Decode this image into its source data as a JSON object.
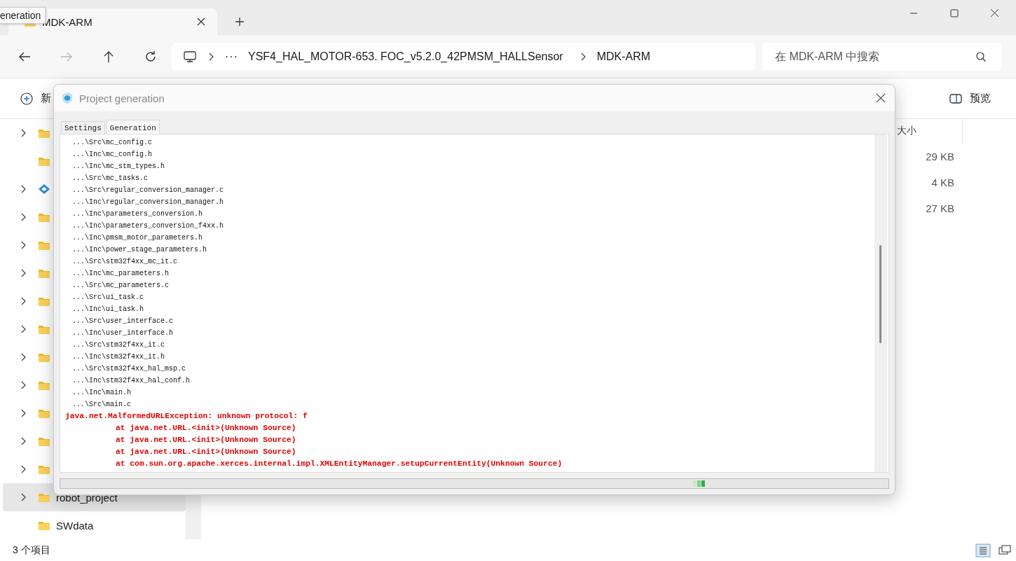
{
  "tooltip": {
    "text": "eneration"
  },
  "tab": {
    "title": "MDK-ARM"
  },
  "nav_buttons": [
    {
      "kind": "back",
      "disabled": false
    },
    {
      "kind": "forward",
      "disabled": true
    },
    {
      "kind": "up",
      "disabled": false
    },
    {
      "kind": "refresh",
      "disabled": false
    }
  ],
  "address": {
    "more": "···",
    "segments": [
      "YSF4_HAL_MOTOR-653. FOC_v5.2.0_42PMSM_HALLSensor",
      "MDK-ARM"
    ]
  },
  "search": {
    "placeholder": "在 MDK-ARM 中搜索"
  },
  "command_bar": {
    "new_label": "新",
    "preview_label": "预览"
  },
  "nav_pane": [
    {
      "kind": "folder",
      "expandable": true,
      "selected": false
    },
    {
      "kind": "folder",
      "expandable": false,
      "selected": false
    },
    {
      "kind": "app",
      "expandable": true,
      "selected": false
    },
    {
      "kind": "folder",
      "expandable": true,
      "selected": false
    },
    {
      "kind": "folder",
      "expandable": true,
      "selected": false
    },
    {
      "kind": "folder",
      "expandable": true,
      "selected": false
    },
    {
      "kind": "folder",
      "expandable": true,
      "selected": false
    },
    {
      "kind": "folder",
      "expandable": true,
      "selected": false
    },
    {
      "kind": "folder",
      "expandable": true,
      "selected": false
    },
    {
      "kind": "folder",
      "expandable": true,
      "selected": false
    },
    {
      "kind": "folder",
      "expandable": true,
      "selected": false
    },
    {
      "kind": "folder",
      "expandable": true,
      "selected": false
    },
    {
      "kind": "folder",
      "expandable": true,
      "selected": false
    },
    {
      "kind": "folder",
      "expandable": true,
      "label": "robot_project",
      "selected": true
    },
    {
      "kind": "folder",
      "expandable": false,
      "label": "SWdata",
      "selected": false
    }
  ],
  "file_list": {
    "size_column": "大小",
    "rows": [
      {
        "size": "29 KB"
      },
      {
        "size": "4 KB"
      },
      {
        "size": "27 KB"
      }
    ]
  },
  "status_bar": {
    "count": "3 个项目"
  },
  "dialog": {
    "title": "Project generation",
    "progress": {
      "indeterminate": true
    },
    "tabs": [
      {
        "label": "Settings",
        "selected": false
      },
      {
        "label": "Generation",
        "selected": true
      }
    ],
    "log": [
      {
        "kind": "file",
        "text": "...\\Src\\mc_config.c"
      },
      {
        "kind": "file",
        "text": "...\\Inc\\mc_config.h"
      },
      {
        "kind": "file",
        "text": "...\\Inc\\mc_stm_types.h"
      },
      {
        "kind": "file",
        "text": "...\\Src\\mc_tasks.c"
      },
      {
        "kind": "file",
        "text": "...\\Src\\regular_conversion_manager.c"
      },
      {
        "kind": "file",
        "text": "...\\Inc\\regular_conversion_manager.h"
      },
      {
        "kind": "file",
        "text": "...\\Inc\\parameters_conversion.h"
      },
      {
        "kind": "file",
        "text": "...\\Inc\\parameters_conversion_f4xx.h"
      },
      {
        "kind": "file",
        "text": "...\\Inc\\pmsm_motor_parameters.h"
      },
      {
        "kind": "file",
        "text": "...\\Inc\\power_stage_parameters.h"
      },
      {
        "kind": "file",
        "text": "...\\Src\\stm32f4xx_mc_it.c"
      },
      {
        "kind": "file",
        "text": "...\\Inc\\mc_parameters.h"
      },
      {
        "kind": "file",
        "text": "...\\Src\\mc_parameters.c"
      },
      {
        "kind": "file",
        "text": "...\\Src\\ui_task.c"
      },
      {
        "kind": "file",
        "text": "...\\Inc\\ui_task.h"
      },
      {
        "kind": "file",
        "text": "...\\Src\\user_interface.c"
      },
      {
        "kind": "file",
        "text": "...\\Inc\\user_interface.h"
      },
      {
        "kind": "file",
        "text": "...\\Src\\stm32f4xx_it.c"
      },
      {
        "kind": "file",
        "text": "...\\Inc\\stm32f4xx_it.h"
      },
      {
        "kind": "file",
        "text": "...\\Src\\stm32f4xx_hal_msp.c"
      },
      {
        "kind": "file",
        "text": "...\\Inc\\stm32f4xx_hal_conf.h"
      },
      {
        "kind": "file",
        "text": "...\\Inc\\main.h"
      },
      {
        "kind": "file",
        "text": "...\\Src\\main.c"
      },
      {
        "kind": "error",
        "text": "java.net.MalformedURLException: unknown protocol: f"
      },
      {
        "kind": "trace",
        "text": "at java.net.URL.<init>(Unknown Source)"
      },
      {
        "kind": "trace",
        "text": "at java.net.URL.<init>(Unknown Source)"
      },
      {
        "kind": "trace",
        "text": "at java.net.URL.<init>(Unknown Source)"
      },
      {
        "kind": "trace",
        "text": "at com.sun.org.apache.xerces.internal.impl.XMLEntityManager.setupCurrentEntity(Unknown Source)"
      }
    ]
  }
}
